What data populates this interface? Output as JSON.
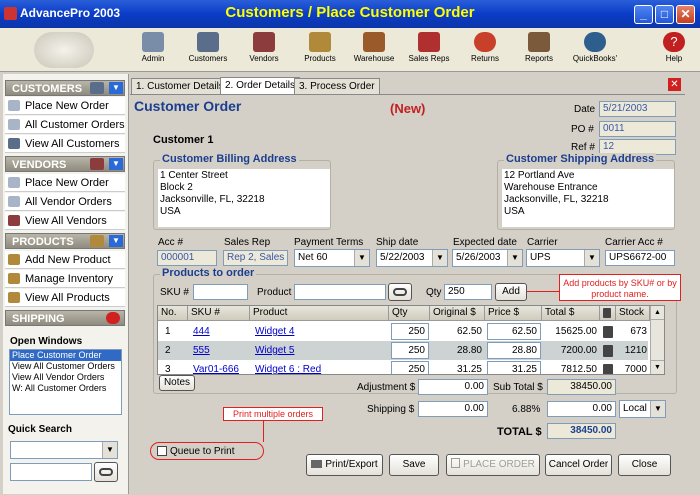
{
  "app": {
    "name": "AdvancePro 2003",
    "window_title": "Customers / Place Customer Order"
  },
  "window_controls": {
    "minimize": "_",
    "maximize": "□",
    "close": "✕"
  },
  "toolbar": [
    {
      "label": "Admin",
      "icon": "admin-icon"
    },
    {
      "label": "Customers",
      "icon": "customers-icon"
    },
    {
      "label": "Vendors",
      "icon": "vendors-icon"
    },
    {
      "label": "Products",
      "icon": "products-icon"
    },
    {
      "label": "Warehouse",
      "icon": "warehouse-icon"
    },
    {
      "label": "Sales Reps",
      "icon": "sales-reps-icon"
    },
    {
      "label": "Returns",
      "icon": "returns-icon"
    },
    {
      "label": "Reports",
      "icon": "reports-icon"
    },
    {
      "label": "QuickBooks'",
      "icon": "quickbooks-icon"
    },
    {
      "label": "Help",
      "icon": "help-icon"
    }
  ],
  "sidebar": {
    "sections": [
      {
        "title": "CUSTOMERS",
        "items": [
          "Place New Order",
          "All Customer Orders",
          "View All Customers"
        ]
      },
      {
        "title": "VENDORS",
        "items": [
          "Place New Order",
          "All Vendor Orders",
          "View All Vendors"
        ]
      },
      {
        "title": "PRODUCTS",
        "items": [
          "Add New Product",
          "Manage Inventory",
          "View All Products"
        ]
      },
      {
        "title": "SHIPPING",
        "items": []
      }
    ],
    "open_windows_title": "Open Windows",
    "open_windows": [
      "Place Customer Order",
      "View All Customer Orders",
      "View All Vendor Orders",
      "W: All Customer Orders"
    ],
    "quick_search_title": "Quick Search"
  },
  "tabs": [
    "1. Customer Details",
    "2. Order Details",
    "3. Process Order"
  ],
  "order": {
    "heading": "Customer Order",
    "status": "(New)",
    "date_label": "Date",
    "date": "5/21/2003",
    "po_label": "PO #",
    "po": "0011",
    "ref_label": "Ref #",
    "ref": "12",
    "customer_name": "Customer 1"
  },
  "billing": {
    "legend": "Customer Billing Address",
    "lines": [
      "1 Center Street",
      "Block 2",
      "Jacksonville, FL, 32218",
      "USA"
    ]
  },
  "shipping": {
    "legend": "Customer Shipping Address",
    "lines": [
      "12 Portland Ave",
      "Warehouse Entrance",
      "Jacksonville, FL, 32218",
      "USA"
    ]
  },
  "fields": {
    "acc_label": "Acc #",
    "acc": "000001",
    "rep_label": "Sales Rep",
    "rep": "Rep 2, Sales",
    "terms_label": "Payment Terms",
    "terms": "Net 60",
    "shipdate_label": "Ship date",
    "shipdate": "5/22/2003",
    "expdate_label": "Expected date",
    "expdate": "5/26/2003",
    "carrier_label": "Carrier",
    "carrier": "UPS",
    "carrier_acc_label": "Carrier Acc #",
    "carrier_acc": "UPS6672-00"
  },
  "products": {
    "legend": "Products to order",
    "sku_label": "SKU #",
    "product_label": "Product",
    "qty_label": "Qty",
    "qty": "250",
    "add_label": "Add",
    "hint": "Add products by SKU# or by product name.",
    "columns": [
      "No.",
      "SKU #",
      "Product",
      "Qty",
      "Original $",
      "Price $",
      "Total $",
      "",
      "Stock"
    ],
    "rows": [
      {
        "no": "1",
        "sku": "444",
        "product": "Widget 4",
        "qty": "250",
        "original": "62.50",
        "price": "62.50",
        "total": "15625.00",
        "stock": "673"
      },
      {
        "no": "2",
        "sku": "555",
        "product": "Widget 5",
        "qty": "250",
        "original": "28.80",
        "price": "28.80",
        "total": "7200.00",
        "stock": "1210"
      },
      {
        "no": "3",
        "sku": "Var01-666",
        "product": "Widget 6 : Red",
        "qty": "250",
        "original": "31.25",
        "price": "31.25",
        "total": "7812.50",
        "stock": "7000"
      }
    ]
  },
  "totals": {
    "notes_label": "Notes",
    "adjustment_label": "Adjustment $",
    "adjustment": "0.00",
    "subtotal_label": "Sub Total $",
    "subtotal": "38450.00",
    "shipping_label": "Shipping $",
    "shipping": "0.00",
    "tax_rate": "6.88%",
    "tax": "0.00",
    "tax_scope": "Local",
    "total_label": "TOTAL $",
    "total": "38450.00"
  },
  "print_hint": "Print multiple orders",
  "queue_label": "Queue to Print",
  "buttons": {
    "print": "Print/Export",
    "save": "Save",
    "place": "PLACE ORDER",
    "cancel": "Cancel Order",
    "close": "Close"
  }
}
